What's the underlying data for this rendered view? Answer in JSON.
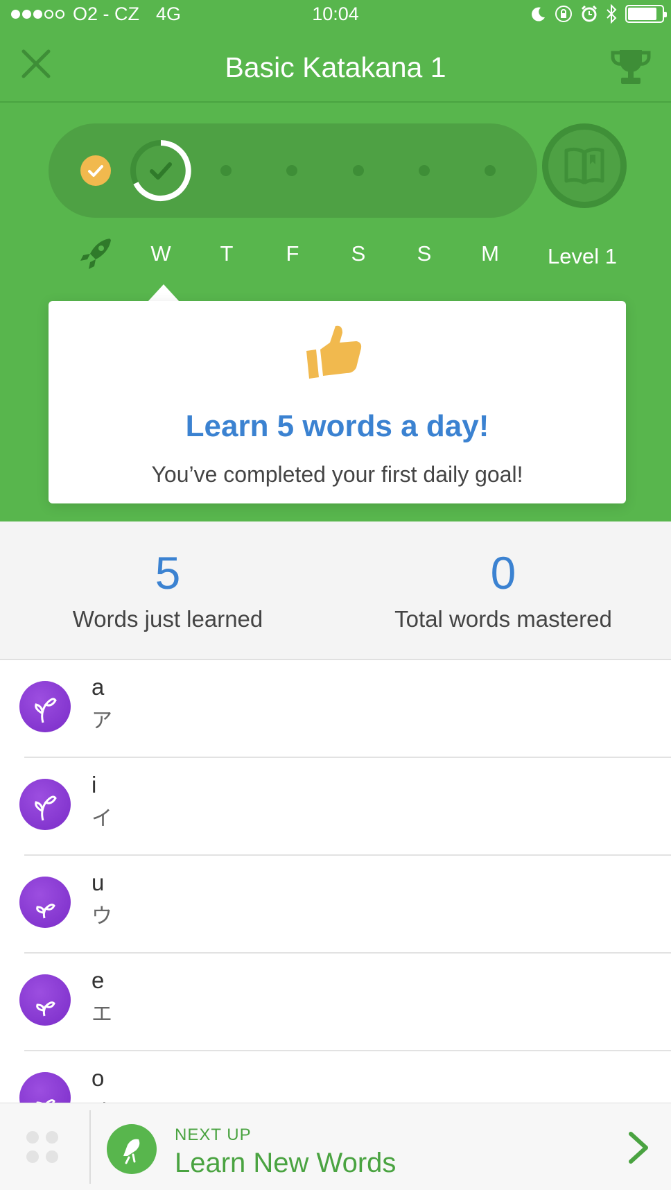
{
  "status": {
    "carrier": "O2 - CZ",
    "network": "4G",
    "time": "10:04",
    "signal_bars_filled": 3,
    "signal_bars_total": 5,
    "battery_level": 0.85
  },
  "header": {
    "title": "Basic Katakana 1",
    "close_icon": "close-icon",
    "trophy_icon": "trophy-icon"
  },
  "progress": {
    "days": [
      "W",
      "T",
      "F",
      "S",
      "S",
      "M"
    ],
    "level": "Level 1",
    "current_day_index": 0
  },
  "goal_card": {
    "icon": "thumbs-up-icon",
    "heading": "Learn 5 words a day!",
    "message": "You’ve completed your first daily goal!"
  },
  "stats": {
    "learned_value": "5",
    "learned_label": "Words just learned",
    "mastered_value": "0",
    "mastered_label": "Total words mastered"
  },
  "words": [
    {
      "romaji": "a",
      "kana": "ア"
    },
    {
      "romaji": "i",
      "kana": "イ"
    },
    {
      "romaji": "u",
      "kana": "ウ"
    },
    {
      "romaji": "e",
      "kana": "エ"
    },
    {
      "romaji": "o",
      "kana": "オ"
    }
  ],
  "next_up": {
    "label": "NEXT UP",
    "title": "Learn New Words"
  },
  "colors": {
    "brand_green": "#58b64d",
    "accent_blue": "#3b82d1",
    "plant_purple": "#8a3bd6",
    "done_yellow": "#f1b94e"
  }
}
